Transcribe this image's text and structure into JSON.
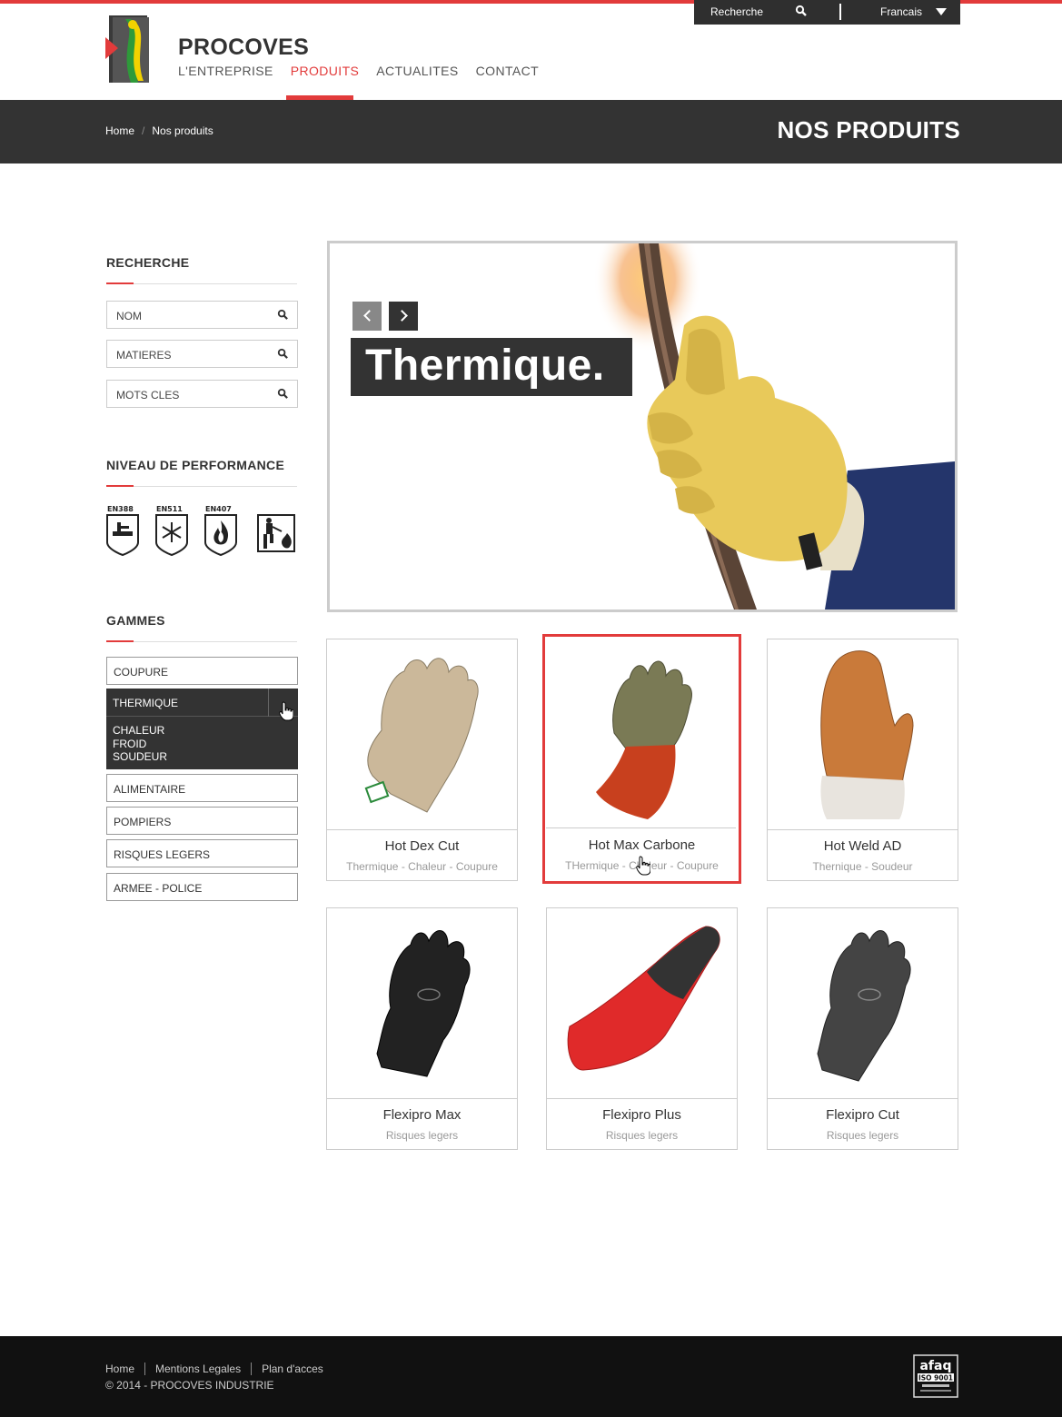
{
  "utility": {
    "search_label": "Recherche",
    "language": "Francais"
  },
  "header": {
    "brand": "PROCOVES",
    "nav": [
      "L'ENTREPRISE",
      "PRODUITS",
      "ACTUALITES",
      "CONTACT"
    ],
    "active_nav": "PRODUITS"
  },
  "band": {
    "crumbs": [
      "Home",
      "Nos produits"
    ],
    "title": "NOS PRODUITS"
  },
  "sidebar": {
    "search_heading": "RECHERCHE",
    "fields": [
      "NOM",
      "MATIERES",
      "MOTS CLES"
    ],
    "performance_heading": "NIVEAU DE PERFORMANCE",
    "performance": [
      {
        "code": "EN388",
        "icon": "mechanical-risk-icon"
      },
      {
        "code": "EN511",
        "icon": "cold-icon"
      },
      {
        "code": "EN407",
        "icon": "heat-flame-icon"
      },
      {
        "code": "",
        "icon": "welding-icon"
      }
    ],
    "ranges_heading": "GAMMES",
    "ranges": [
      "COUPURE",
      "THERMIQUE",
      "ALIMENTAIRE",
      "POMPIERS",
      "RISQUES LEGERS",
      "ARMEE - POLICE"
    ],
    "active_range": "THERMIQUE",
    "active_subranges": [
      "CHALEUR",
      "FROID",
      "SOUDEUR"
    ]
  },
  "slider": {
    "title": "Thermique."
  },
  "products": [
    {
      "name": "Hot Dex Cut",
      "category": "Thermique - Chaleur - Coupure",
      "color": "#cbb89a",
      "selected": false
    },
    {
      "name": "Hot Max Carbone",
      "category": "THermique - Chaleur - Coupure",
      "color": "#7a7a55",
      "selected": true
    },
    {
      "name": "Hot Weld AD",
      "category": "Thernique - Soudeur",
      "color": "#c97a3a",
      "selected": false
    },
    {
      "name": "Flexipro Max",
      "category": "Risques legers",
      "color": "#222222",
      "selected": false
    },
    {
      "name": "Flexipro Plus",
      "category": "Risques legers",
      "color": "#e02a2a",
      "selected": false
    },
    {
      "name": "Flexipro Cut",
      "category": "Risques legers",
      "color": "#444444",
      "selected": false
    }
  ],
  "footer": {
    "links": [
      "Home",
      "Mentions Legales",
      "Plan d'acces"
    ],
    "copyright": "© 2014 - PROCOVES INDUSTRIE",
    "cert_logo": {
      "brand": "afaq",
      "badge": "ISO 9001"
    }
  },
  "colors": {
    "accent": "#e23b3b",
    "dark": "#333333",
    "footer": "#111111"
  }
}
